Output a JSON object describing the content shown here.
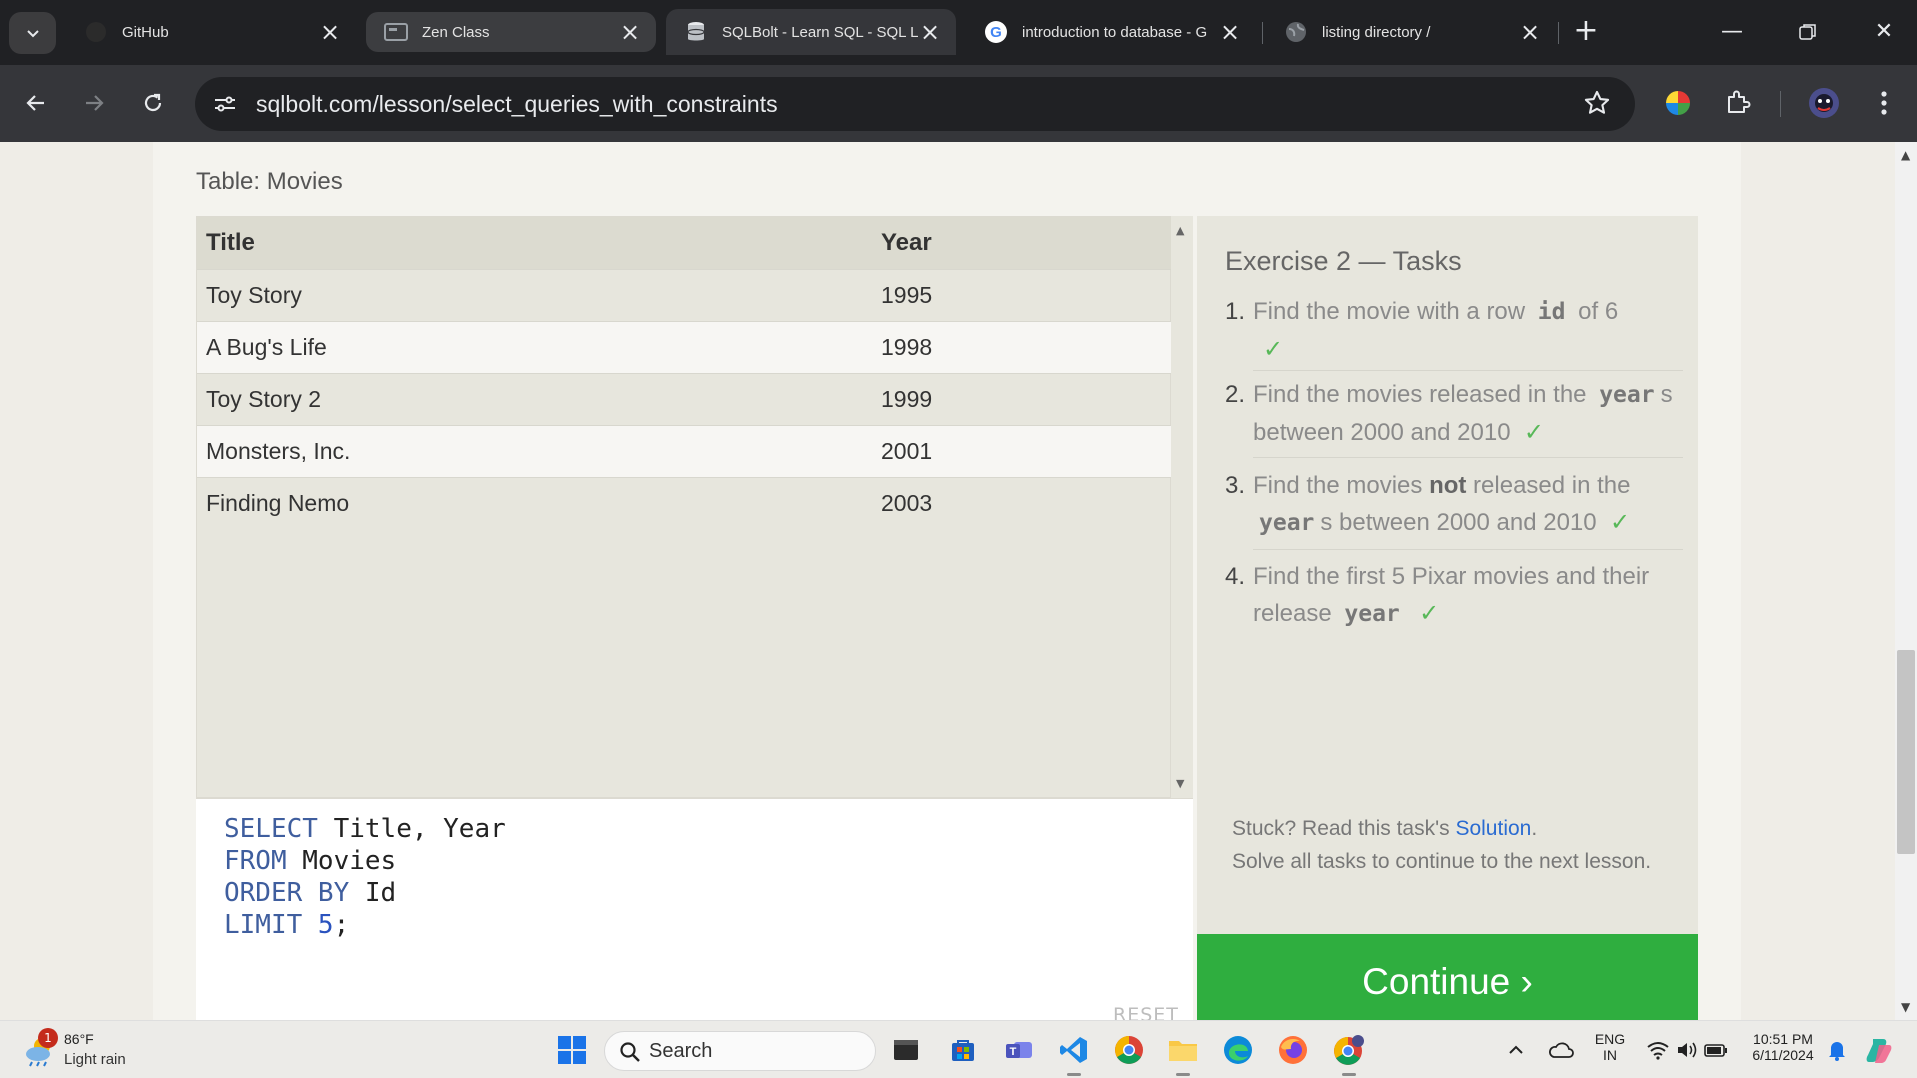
{
  "browser": {
    "tabs": [
      {
        "title": "GitHub",
        "icon": "github-icon",
        "state": "inactive"
      },
      {
        "title": "Zen Class",
        "icon": "zen-class-icon",
        "state": "inactive"
      },
      {
        "title": "SQLBolt - Learn SQL - SQL L",
        "icon": "database-icon",
        "state": "active"
      },
      {
        "title": "introduction to database - G",
        "icon": "google-icon",
        "state": "inactive"
      },
      {
        "title": "listing directory /",
        "icon": "globe-icon",
        "state": "inactive"
      }
    ],
    "url": "sqlbolt.com/lesson/select_queries_with_constraints"
  },
  "page": {
    "table_caption": "Table: Movies",
    "columns": [
      "Title",
      "Year"
    ],
    "rows": [
      {
        "title": "Toy Story",
        "year": "1995"
      },
      {
        "title": "A Bug's Life",
        "year": "1998"
      },
      {
        "title": "Toy Story 2",
        "year": "1999"
      },
      {
        "title": "Monsters, Inc.",
        "year": "2001"
      },
      {
        "title": "Finding Nemo",
        "year": "2003"
      }
    ],
    "query": {
      "kw_select": "SELECT",
      "select_cols": " Title, Year",
      "kw_from": "FROM",
      "from_table": " Movies",
      "kw_order": "ORDER BY",
      "order_col": " Id",
      "kw_limit": "LIMIT",
      "limit_num": " 5",
      "terminator": ";"
    },
    "reset_label": "RESET",
    "tasks_title": "Exercise 2 — Tasks",
    "tasks": [
      {
        "n": "1.",
        "pre": "Find the movie with a row ",
        "code": "id",
        "post": " of 6",
        "check": "✓"
      },
      {
        "n": "2.",
        "pre": "Find the movies released in the ",
        "code": "year",
        "post": "s between 2000 and 2010",
        "check": "✓"
      },
      {
        "n": "3.",
        "pre": "Find the movies ",
        "bold": "not",
        "mid": " released in the ",
        "code": "year",
        "post": "s between 2000 and 2010",
        "check": "✓"
      },
      {
        "n": "4.",
        "pre": "Find the first 5 Pixar movies and their release ",
        "code": "year",
        "post": "",
        "check": "✓"
      }
    ],
    "stuck_pre": "Stuck? Read this task's ",
    "stuck_link": "Solution",
    "stuck_post": ".",
    "solve_text": "Solve all tasks to continue to the next lesson.",
    "continue_label": "Continue ›"
  },
  "taskbar": {
    "weather_temp": "86°F",
    "weather_desc": "Light rain",
    "weather_badge": "1",
    "search_label": "Search",
    "lang_1": "ENG",
    "lang_2": "IN",
    "time": "10:51 PM",
    "date": "6/11/2024"
  },
  "colors": {
    "accent_green": "#2fae3f",
    "link_blue": "#2a6bd1",
    "check_green": "#58b858"
  }
}
